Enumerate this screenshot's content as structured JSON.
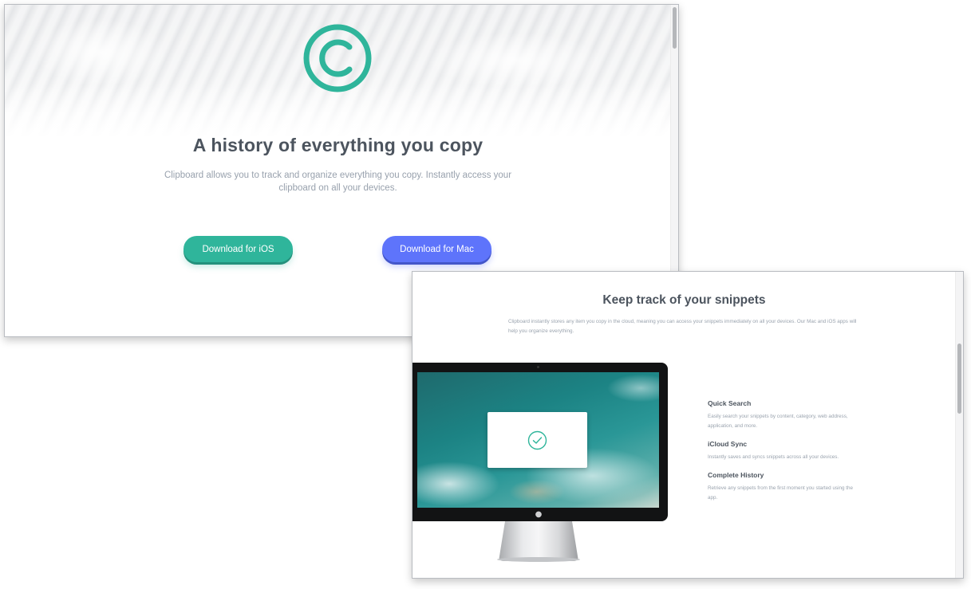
{
  "hero": {
    "title": "A history of everything you copy",
    "subtitle": "Clipboard allows you to track and organize everything you copy. Instantly access your clipboard on all your devices.",
    "buttons": {
      "ios": "Download for iOS",
      "mac": "Download for Mac"
    }
  },
  "snippets": {
    "title": "Keep track of your snippets",
    "subtitle": "Clipboard instantly stores any item you copy in the cloud, meaning you can access your snippets immediately on all your devices. Our Mac and iOS apps will help you organize everything.",
    "features": [
      {
        "title": "Quick Search",
        "text": "Easily search your snippets by content, category, web address, application, and more."
      },
      {
        "title": "iCloud Sync",
        "text": "Instantly saves and syncs snippets across all your devices."
      },
      {
        "title": "Complete History",
        "text": "Retrieve any snippets from the first moment you started using the app."
      }
    ]
  },
  "icons": {
    "logo": "copyright-logo-icon",
    "check": "check-circle-icon",
    "apple": "apple-logo-icon"
  },
  "colors": {
    "accent_green": "#2fb59b",
    "accent_blue": "#5e74fb",
    "heading": "#4c545e",
    "body_text": "#98a1ad"
  }
}
